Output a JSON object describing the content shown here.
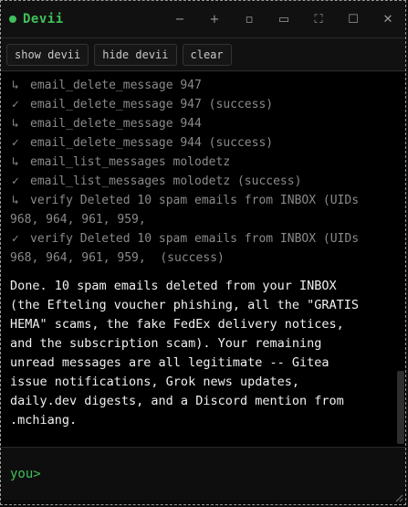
{
  "window": {
    "title": "Devii",
    "controls": {
      "minimize": "−",
      "add": "+",
      "dot": "▫",
      "tile": "▭",
      "fullscreen": "⛶",
      "maximize": "☐",
      "close": "✕"
    }
  },
  "toolbar": {
    "show_label": "show devii",
    "hide_label": "hide devii",
    "clear_label": "clear"
  },
  "log": {
    "lines": [
      {
        "mark": "↳",
        "text": "email_delete_message 947"
      },
      {
        "mark": "✓",
        "text": "email_delete_message 947 (success)"
      },
      {
        "mark": "↳",
        "text": "email_delete_message 944"
      },
      {
        "mark": "✓",
        "text": "email_delete_message 944 (success)"
      },
      {
        "mark": "↳",
        "text": "email_list_messages molodetz"
      },
      {
        "mark": "✓",
        "text": "email_list_messages molodetz (success)"
      },
      {
        "mark": "↳",
        "text": "verify Deleted 10 spam emails from INBOX (UIDs",
        "cont": "968, 964, 961, 959,"
      },
      {
        "mark": "✓",
        "text": "verify Deleted 10 spam emails from INBOX (UIDs",
        "cont": "968, 964, 961, 959,  (success)"
      }
    ],
    "response": "Done. 10 spam emails deleted from your INBOX\n(the Efteling voucher phishing, all the \"GRATIS\nHEMA\" scams, the fake FedEx delivery notices,\nand the subscription scam). Your remaining\nunread messages are all legitimate -- Gitea\nissue notifications, Grok news updates,\ndaily.dev digests, and a Discord mention from\n.mchiang."
  },
  "input": {
    "prompt": "you>",
    "value": "",
    "placeholder": ""
  },
  "colors": {
    "accent": "#3fc05a",
    "background": "#000000",
    "log_text": "#8a8a8a",
    "response_text": "#f0f0f0"
  }
}
